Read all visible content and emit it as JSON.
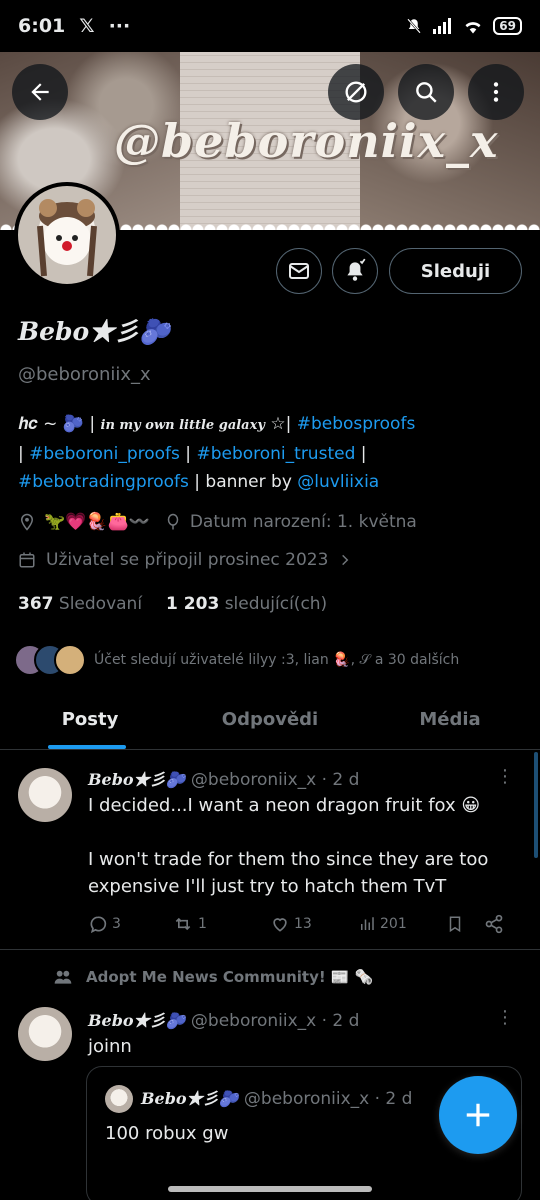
{
  "status_bar": {
    "time": "6:01",
    "x_icon": "𝕏",
    "more": "···",
    "battery": "69"
  },
  "banner": {
    "text": "@beboroniix_x"
  },
  "profile": {
    "display_name": "𝑩𝒆𝒃𝒐★彡🫐",
    "handle": "@beboroniix_x",
    "follow_label": "Sleduji",
    "bio": {
      "prefix": "𝒉𝒄 ~ 🫐 | ",
      "fancy": "𝒊𝒏 𝒎𝒚 𝒐𝒘𝒏 𝒍𝒊𝒕𝒕𝒍𝒆 𝒈𝒂𝒍𝒂𝒙𝒚",
      "star": " ☆| ",
      "tag1": "#bebosproofs",
      "sep1": "| ",
      "tag2": "#beboroni_proofs",
      "sep2": " | ",
      "tag3": "#beboroni_trusted",
      "sep3": " |",
      "tag4": "#bebotradingproofs",
      "sep4": " | banner by ",
      "mention": "@luvliixia"
    },
    "location": "🦖💗🪼👛〰️",
    "birthday": "Datum narození: 1. května",
    "joined": "Uživatel se připojil prosinec 2023",
    "following_count": "367",
    "following_label": "Sledovaní",
    "followers_count": "1 203",
    "followers_label": "sledující(ch)",
    "followed_by": "Účet sledují uživatelé lilyy :3, lian 🪼, 𝒮 a 30 dalších"
  },
  "tabs": [
    "Posty",
    "Odpovědi",
    "Média"
  ],
  "tweets": [
    {
      "name": "𝑩𝒆𝒃𝒐★彡🫐",
      "handle": "@beboroniix_x",
      "time": "· 2 d",
      "text1": "I decided...I want a neon dragon fruit fox 😀",
      "text2": "I won't trade for them tho since they are too expensive I'll just try to hatch them TvT",
      "replies": "3",
      "reposts": "1",
      "likes": "13",
      "views": "201"
    },
    {
      "community": "Adopt Me News Community! 📰 🗞️",
      "name": "𝑩𝒆𝒃𝒐★彡🫐",
      "handle": "@beboroniix_x",
      "time": "· 2 d",
      "text": "joinn",
      "quote": {
        "name": "𝑩𝒆𝒃𝒐★彡🫐",
        "handle": "@beboroniix_x",
        "time": "· 2 d",
        "text": "100 robux gw"
      }
    }
  ],
  "icons": {
    "back": "arrow-left-icon",
    "no_notif": "eye-slash-icon",
    "search": "search-icon",
    "message": "envelope-icon",
    "notify": "bell-plus-icon",
    "compose": "plus-icon"
  },
  "colors": {
    "accent": "#1d9bf0",
    "background": "#000000",
    "muted": "#71767b"
  }
}
